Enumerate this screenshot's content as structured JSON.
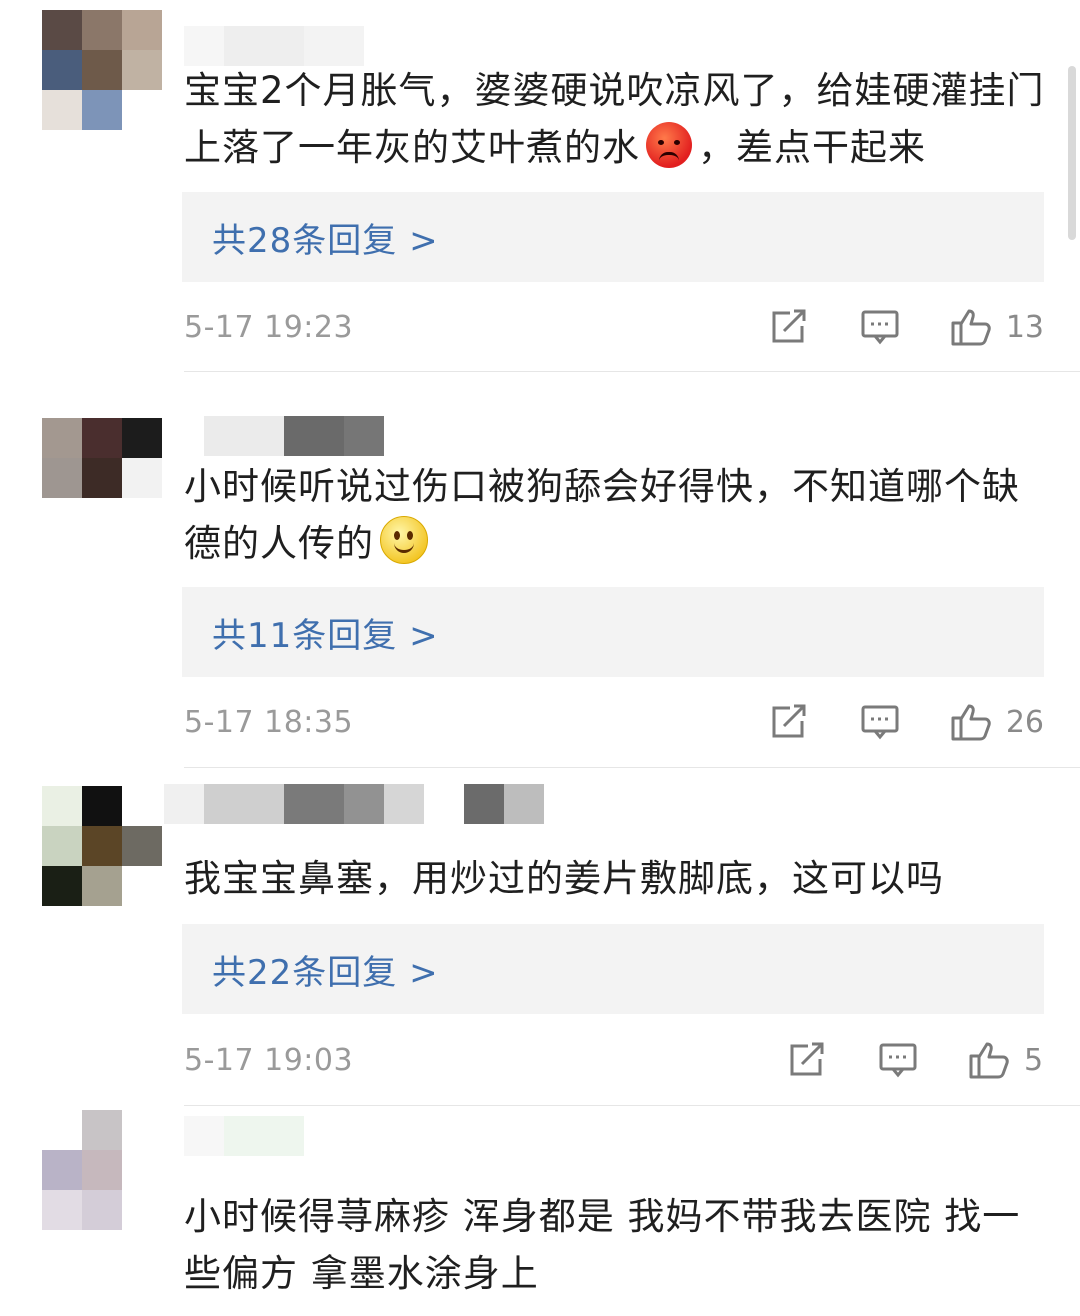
{
  "comments": [
    {
      "text_parts": [
        "宝宝2个月胀气，婆婆硬说吹凉风了，给娃硬灌挂门上落了一年灰的艾叶煮的水",
        "，差点干起来"
      ],
      "emoji": "angry-face-emoji",
      "replies_label": "共28条回复 >",
      "time": "5-17 19:23",
      "likes": "13",
      "avatar_colors": [
        "#5a4a45",
        "#8b7769",
        "#b8a595",
        "#4a5d7c",
        "#6e5a4a",
        "#c0b2a3",
        "#e6e0da",
        "#7d94b8",
        "#ffffff"
      ],
      "name_colors": [
        "#f6f6f6",
        "#eeeeee",
        "#f3f3f3"
      ]
    },
    {
      "text_parts": [
        "小时候听说过伤口被狗舔会好得快，不知道哪个缺德的人传的",
        ""
      ],
      "emoji": "smile-emoji",
      "replies_label": "共11条回复 >",
      "time": "5-17 18:35",
      "likes": "26",
      "avatar_colors": [
        "#a39890",
        "#4a2e2e",
        "#1c1c1c",
        "#9e9691",
        "#3d2b26",
        "#f2f2f2",
        "#ffffff",
        "#ffffff",
        "#ffffff"
      ],
      "name_colors": [
        "#ffffff",
        "#ebebeb",
        "#6a6a6a",
        "#767676"
      ]
    },
    {
      "text_parts": [
        "我宝宝鼻塞，用炒过的姜片敷脚底，这可以吗",
        ""
      ],
      "emoji": "",
      "replies_label": "共22条回复 >",
      "time": "5-17 19:03",
      "likes": "5",
      "avatar_colors": [
        "#eaf0e4",
        "#111111",
        "#ffffff",
        "#c9d3c0",
        "#5b4526",
        "#6d6a62",
        "#1a1f15",
        "#a5a190",
        "#ffffff"
      ],
      "name_colors": [
        "#f0f0f0",
        "#cfcfcf",
        "#7a7a7a",
        "#929292",
        "#d6d6d6",
        "#ffffff",
        "#6b6b6b",
        "#bdbdbd"
      ]
    },
    {
      "text_parts": [
        "小时候得荨麻疹 浑身都是 我妈不带我去医院 找一些偏方 拿墨水涂身上",
        ""
      ],
      "emoji": "",
      "replies_label": "",
      "time": "",
      "likes": "",
      "avatar_colors": [
        "#ffffff",
        "#c8c4c6",
        "#ffffff",
        "#b9b3c7",
        "#c6b8bd",
        "#ffffff",
        "#e2dce4",
        "#d4cdd8",
        "#ffffff"
      ],
      "name_colors": [
        "#f7f7f7",
        "#eef6ee"
      ]
    }
  ],
  "icons": {
    "share": "share-icon",
    "comment": "comment-icon",
    "like": "thumbs-up-icon"
  },
  "colors": {
    "reply_link": "#3f6fae",
    "reply_bg": "#f3f3f3",
    "meta": "#9a9a9a"
  }
}
